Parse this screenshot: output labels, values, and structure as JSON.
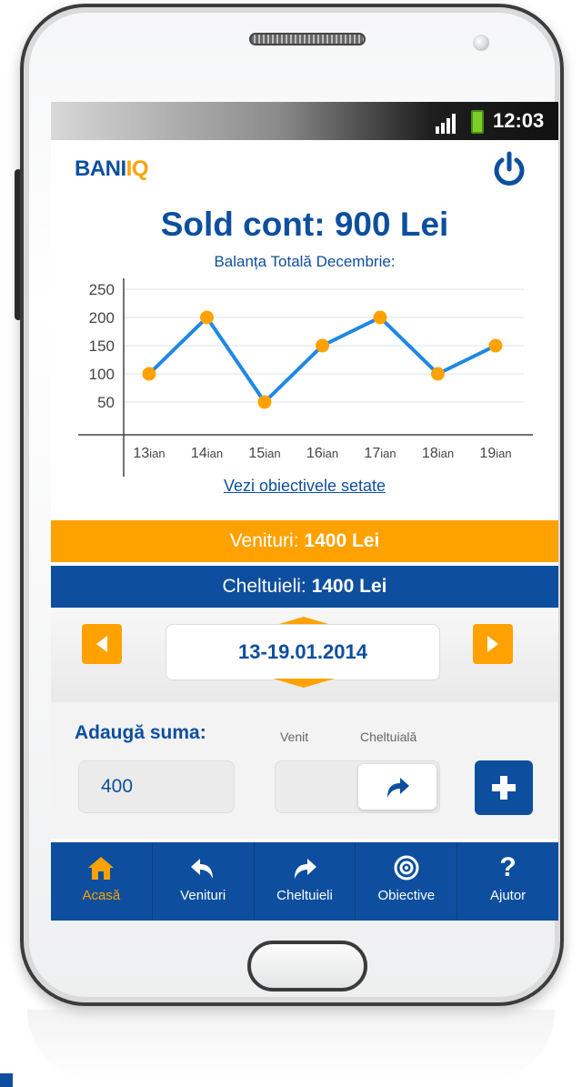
{
  "status_bar": {
    "time": "12:03"
  },
  "app": {
    "logo_text": "BANI",
    "logo_suffix": "IQ"
  },
  "balance": {
    "headline": "Sold cont: 900 Lei",
    "subtitle": "Balanța Totală Decembrie:"
  },
  "chart_data": {
    "type": "line",
    "categories": [
      "13ian",
      "14ian",
      "15ian",
      "16ian",
      "17ian",
      "18ian",
      "19ian"
    ],
    "values": [
      100,
      200,
      50,
      150,
      200,
      100,
      150
    ],
    "y_ticks": [
      50,
      100,
      150,
      200,
      250
    ],
    "ylim": [
      0,
      260
    ],
    "title": "",
    "xlabel": "",
    "ylabel": "",
    "grid": true,
    "line_color": "#1e88e5",
    "marker_color": "#ffa200"
  },
  "links": {
    "view_goals": "Vezi obiectivele setate"
  },
  "summary": {
    "income_label": "Venituri:",
    "income_value": "1400 Lei",
    "expense_label": "Cheltuieli:",
    "expense_value": "1400 Lei"
  },
  "period": {
    "range": "13-19.01.2014"
  },
  "add": {
    "title": "Adaugă suma:",
    "income_label": "Venit",
    "expense_label": "Cheltuială",
    "amount_value": "400"
  },
  "tabs": [
    {
      "label": "Acasă",
      "icon": "home-icon",
      "active": true
    },
    {
      "label": "Venituri",
      "icon": "income-arrow-icon",
      "active": false
    },
    {
      "label": "Cheltuieli",
      "icon": "expense-arrow-icon",
      "active": false
    },
    {
      "label": "Obiective",
      "icon": "target-icon",
      "active": false
    },
    {
      "label": "Ajutor",
      "icon": "help-icon",
      "active": false
    }
  ],
  "colors": {
    "brand_blue": "#0d4f9e",
    "accent_orange": "#ffa200"
  }
}
